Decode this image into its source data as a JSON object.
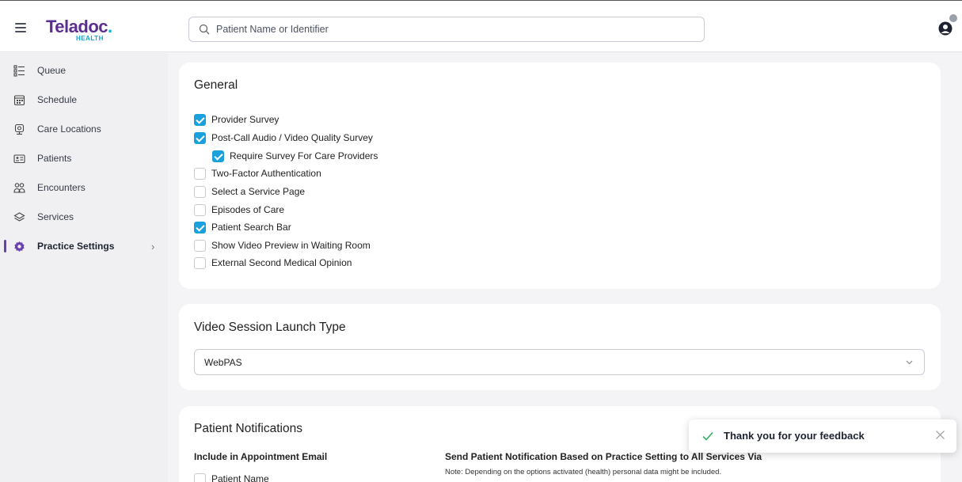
{
  "header": {
    "logo_text": "Teladoc",
    "logo_sub": "HEALTH",
    "search_placeholder": "Patient Name or Identifier"
  },
  "sidebar": {
    "items": [
      {
        "label": "Queue",
        "icon": "queue-icon"
      },
      {
        "label": "Schedule",
        "icon": "calendar-icon"
      },
      {
        "label": "Care Locations",
        "icon": "care-location-icon"
      },
      {
        "label": "Patients",
        "icon": "patient-card-icon"
      },
      {
        "label": "Encounters",
        "icon": "people-icon"
      },
      {
        "label": "Services",
        "icon": "layers-icon"
      },
      {
        "label": "Practice Settings",
        "icon": "gear-icon",
        "active": true
      }
    ]
  },
  "general": {
    "title": "General",
    "options": [
      {
        "label": "Provider Survey",
        "checked": true
      },
      {
        "label": "Post-Call Audio / Video Quality Survey",
        "checked": true
      },
      {
        "label": "Require Survey For Care Providers",
        "checked": true
      },
      {
        "label": "Two-Factor Authentication",
        "checked": false
      },
      {
        "label": "Select a Service Page",
        "checked": false
      },
      {
        "label": "Episodes of Care",
        "checked": false
      },
      {
        "label": "Patient Search Bar",
        "checked": true
      },
      {
        "label": "Show Video Preview in Waiting Room",
        "checked": false
      },
      {
        "label": "External Second Medical Opinion",
        "checked": false
      }
    ]
  },
  "video": {
    "title": "Video Session Launch Type",
    "selected": "WebPAS"
  },
  "notifications": {
    "title": "Patient Notifications",
    "include_heading": "Include in Appointment Email",
    "patient_name_label": "Patient Name",
    "send_heading": "Send Patient Notification Based on Practice Setting to All Services Via",
    "note": "Note: Depending on the options activated (health) personal data might be included."
  },
  "toast": {
    "message": "Thank you for your feedback"
  },
  "colors": {
    "brand_purple": "#5b2e91",
    "brand_cyan": "#00b5e2",
    "checkbox_blue": "#1aa0dc",
    "toast_green": "#2fae5e"
  }
}
